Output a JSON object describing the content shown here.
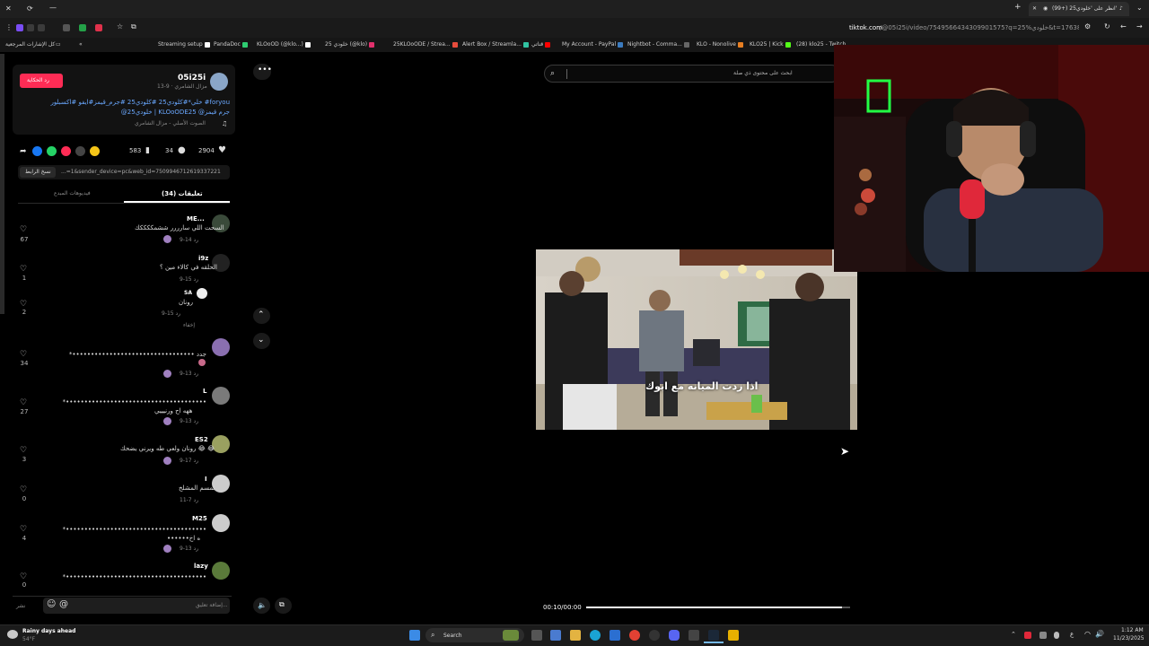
{
  "browser": {
    "tab_title": "(99+) انظر على 'خلودي25' ...",
    "url_host": "tiktok.com",
    "url_path": "/@05i25i/video/7549566434309901575?q=25%خلودي&t=1763847249623",
    "bookmarks": [
      "كل الإشارات المرجعية",
      "Streaming setup",
      "PandaDoc",
      "KLOoOD (@klo...)",
      "خلودي 25 (@klo)",
      "25KLOoODE / Strea...",
      "Alert Box / Streamla...",
      "قناتي",
      "My Account - PayPal",
      "Nightbot - Comma...",
      "KLO - Nonolive",
      "KLO25 | Kick",
      "(28) klo25 - Twitch",
      "Eric's Support A C...",
      "KLOoODE25 - YouT...",
      "Salla",
      "Google",
      "Jacosport | LIVE in ..."
    ]
  },
  "post": {
    "username": "05i25i",
    "subline": "مزال الشامري · 9-13",
    "report_button": "رد الحكاية",
    "caption_line1": "خلي*#كلودي25 #كلودي25 #جرم_قيمز#ايفو #اكسبلور #foryou",
    "caption_line2": "@خلودي25 | KLOoODE25 @جرم قيمز",
    "music": "الصوت الأصلي - مزال الشامري",
    "likes": "2904",
    "comments": "34",
    "saves": "583",
    "link_text": "...=1&sender_device=pc&web_id=7509946712619337221",
    "copy_link_label": "نسخ الرابط"
  },
  "tabs": {
    "comments": "تعليقات (34)",
    "creator_videos": "فيديوهات المبدع"
  },
  "comments": [
    {
      "name": "ME...",
      "text": "السحت اللي سارررر ششمككككك",
      "meta": "9-14  رد",
      "likes": "67"
    },
    {
      "name": "i9z",
      "text": "الحلقه في كالاء مين ؟",
      "meta": "9-15  رد",
      "likes": "1"
    },
    {
      "name": "SA",
      "text": "رونان",
      "meta": "9-15  رد",
      "likes": "2",
      "extra": "إخفاء"
    },
    {
      "name": "‌",
      "text": "*••••••••••••••••••••••••••••••••• جدد",
      "meta": "9-13  رد",
      "likes": "34"
    },
    {
      "name": "L",
      "text": "*••••••••••••••••••••••••••••••••••••••",
      "text2": "ههه اح ورنيييي",
      "meta": "9-13  رد",
      "likes": "27"
    },
    {
      "name": "ES2",
      "text": "رونان ولعي طه ويرني يضحك 😂 😂",
      "meta": "9-17  رد",
      "likes": "3"
    },
    {
      "name": "I",
      "text": "ثمسم المشلخ",
      "meta": "11-7  رد",
      "likes": "0"
    },
    {
      "name": "M25",
      "text": "*••••••••••••••••••••••••••••••••••••••",
      "text2": "••••••ه اخ",
      "meta": "9-13  رد",
      "likes": "4"
    },
    {
      "name": "lazy",
      "text": "*••••••••••••••••••••••••••••••••••••••",
      "meta": "",
      "likes": "0"
    }
  ],
  "comment_input": {
    "placeholder": "إضافة تعليق...",
    "post_label": "نشر"
  },
  "video": {
    "search_placeholder": "ابحث على محتوى ذي صلة",
    "subtitle": "اذا زدت الميانه مع ابوك",
    "time": "00:10/00:00",
    "progress": 0.97
  },
  "taskbar": {
    "weather_title": "Rainy days ahead",
    "weather_temp": "54°F",
    "search_label": "Search",
    "time": "1:12 AM",
    "date": "11/23/2025"
  },
  "colors": {
    "accent_red": "#fe2c55",
    "link_blue": "#6aa8ff",
    "taskbar": "#1b1b1b"
  }
}
